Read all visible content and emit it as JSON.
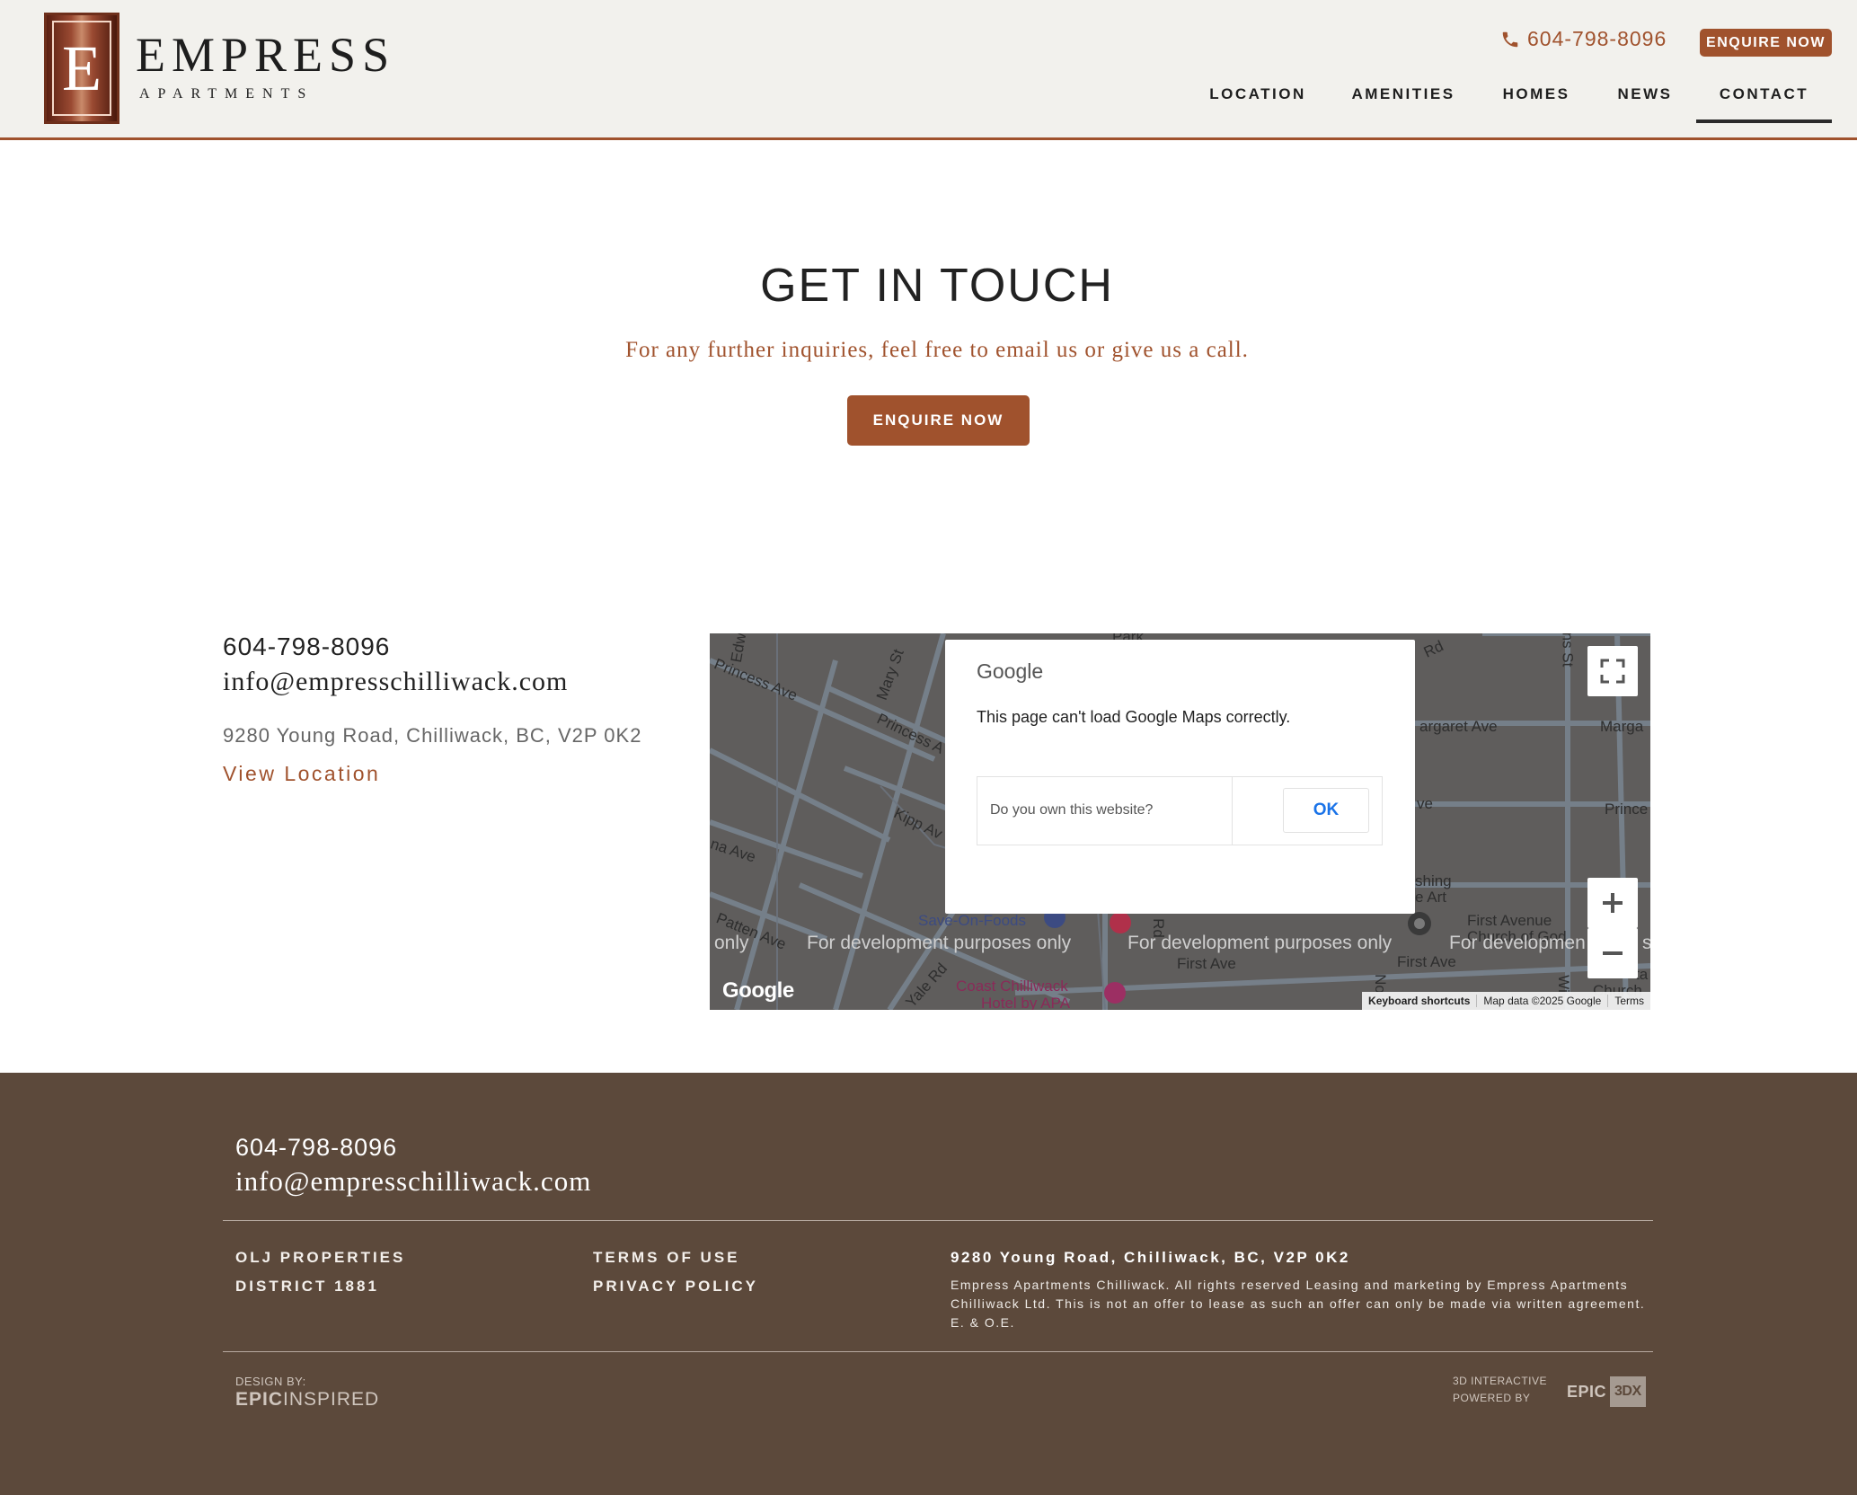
{
  "header": {
    "logo_letter": "E",
    "brand": "EMPRESS",
    "brand_sub": "APARTMENTS",
    "phone": "604-798-8096",
    "enquire_label": "ENQUIRE NOW",
    "nav": [
      {
        "label": "LOCATION"
      },
      {
        "label": "AMENITIES"
      },
      {
        "label": "HOMES"
      },
      {
        "label": "NEWS"
      },
      {
        "label": "CONTACT",
        "active": true
      }
    ]
  },
  "hero": {
    "title": "GET IN TOUCH",
    "subtitle": "For any further inquiries, feel free to email us or give us a call.",
    "button_label": "ENQUIRE NOW"
  },
  "contact": {
    "phone": "604-798-8096",
    "email": "info@empresschilliwack.com",
    "address": "9280 Young Road, Chilliwack, BC, V2P 0K2",
    "view_location": "View Location"
  },
  "map": {
    "streets": [
      "Princess Ave",
      "Mary St",
      "Princess A",
      "Kipp Av",
      "na Ave",
      "Patten Ave",
      "Yale Rd",
      "Edw",
      "Park",
      "Rd",
      "argaret Ave",
      "Marga",
      "ve",
      "Prince",
      "shing",
      "e Art",
      "First Avenue",
      "Church of God",
      "First Ave",
      "First Ave",
      "Church",
      "ns St",
      "Wi",
      "Rd",
      "No",
      "ta"
    ],
    "places": [
      "Save-On-Foods",
      "Coast Chilliwack",
      "Hotel by APA"
    ],
    "dev_notice": "For development purposes only",
    "dev_notice_partial_left": "only",
    "dev_notice_partial_right": "For developmen",
    "dev_notice_tail": "s",
    "google_logo": "Google",
    "footer_links": [
      "Keyboard shortcuts",
      "Map data ©2025 Google",
      "Terms"
    ],
    "dialog": {
      "brand": "Google",
      "message": "This page can't load Google Maps correctly.",
      "question": "Do you own this website?",
      "ok_label": "OK"
    }
  },
  "footer": {
    "phone": "604-798-8096",
    "email": "info@empresschilliwack.com",
    "links_col1": [
      "OLJ PROPERTIES",
      "DISTRICT 1881"
    ],
    "links_col2": [
      "TERMS OF USE",
      "PRIVACY POLICY"
    ],
    "address": "9280 Young Road, Chilliwack, BC, V2P 0K2",
    "legal": "Empress Apartments Chilliwack. All rights reserved Leasing and marketing by Empress Apartments Chilliwack Ltd. This is not an offer to lease as such an offer can only be made via written agreement. E. & O.E.",
    "design_label": "DESIGN BY:",
    "design_brand_bold": "EPIC",
    "design_brand_light": "INSPIRED",
    "powered_line1": "3D INTERACTIVE",
    "powered_line2": "POWERED BY",
    "epic_word": "EPIC",
    "epic_box": "3DX"
  },
  "colors": {
    "accent": "#a0522d",
    "header_bg": "#f2f1ed",
    "footer_bg": "#5c493b",
    "map_bg": "#5f5d5c"
  }
}
